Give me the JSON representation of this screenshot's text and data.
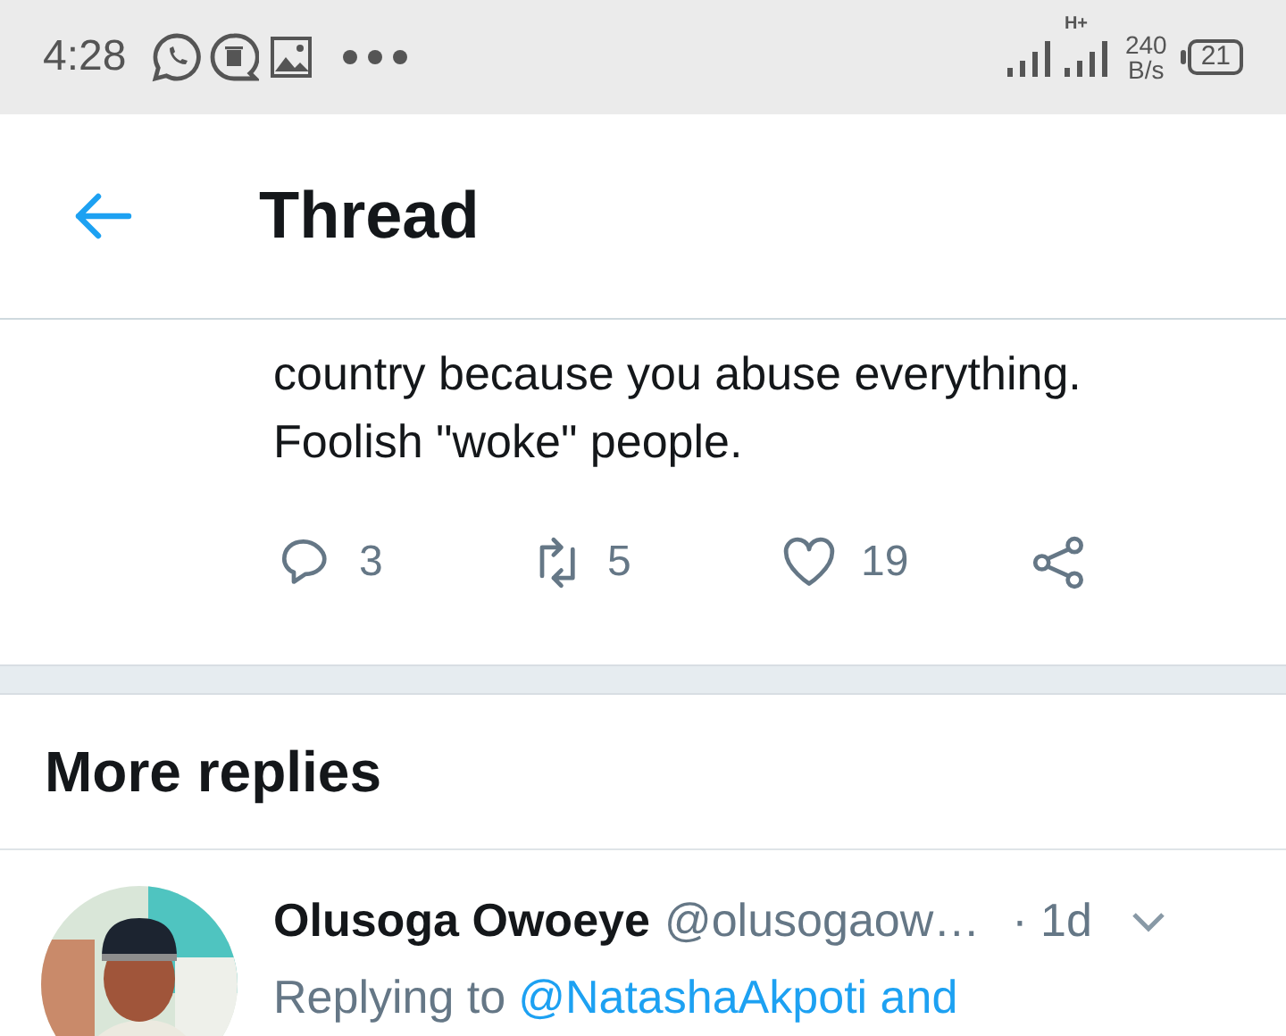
{
  "status_bar": {
    "time": "4:28",
    "network": "H+",
    "speed": "240",
    "speed_unit": "B/s",
    "battery": "21"
  },
  "header": {
    "title": "Thread"
  },
  "tweet": {
    "lines": [
      "country because you abuse everything.",
      "Foolish \"woke\" people."
    ],
    "actions": [
      {
        "kind": "reply",
        "count": "3"
      },
      {
        "kind": "retweet",
        "count": "5"
      },
      {
        "kind": "like",
        "count": "19"
      },
      {
        "kind": "share"
      }
    ]
  },
  "section_title": "More replies",
  "reply": {
    "name": "Olusoga Owoeye",
    "handle": "@olusogaow…",
    "time": "· 1d",
    "replying_label": "Replying to",
    "replying_to": "@NatashaAkpoti and"
  }
}
